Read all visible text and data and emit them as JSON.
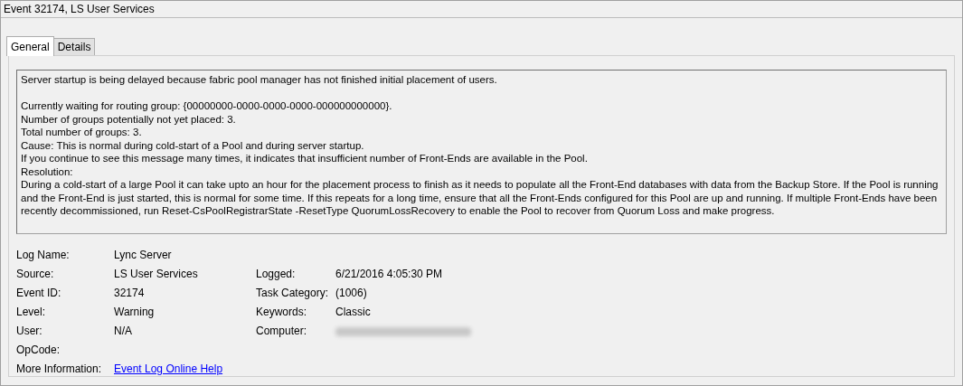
{
  "window": {
    "title": "Event 32174, LS User Services"
  },
  "tabs": [
    {
      "label": "General",
      "selected": true
    },
    {
      "label": "Details",
      "selected": false
    }
  ],
  "message": {
    "summary": "Server startup is being delayed because fabric pool manager has not finished initial placement of users.",
    "paragraphs": [
      "Currently waiting for routing group: {00000000-0000-0000-0000-000000000000}.",
      "Number of groups potentially not yet placed: 3.",
      "Total number of groups: 3.",
      "Cause: This is normal during cold-start of a Pool and during server startup.",
      "If you continue to see this message many times, it indicates that insufficient number of Front-Ends are available in the Pool.",
      "Resolution:",
      "During a cold-start of a large Pool it can take upto an hour for the placement process to finish as it needs to populate all the Front-End databases with data from the Backup Store. If the Pool is running and the Front-End is just started, this is normal for some time. If this repeats for a long time, ensure that all the Front-Ends configured for this Pool are up and running. If multiple Front-Ends have been recently decommissioned, run Reset-CsPoolRegistrarState -ResetType QuorumLossRecovery to enable the Pool to recover from Quorum Loss and make progress."
    ]
  },
  "properties": [
    {
      "left": {
        "label": "Log Name:",
        "value": "Lync Server",
        "kind": "text"
      }
    },
    {
      "left": {
        "label": "Source:",
        "value": "LS User Services",
        "kind": "text"
      },
      "right": {
        "label": "Logged:",
        "value": "6/21/2016 4:05:30 PM",
        "kind": "text"
      }
    },
    {
      "left": {
        "label": "Event ID:",
        "value": "32174",
        "kind": "text"
      },
      "right": {
        "label": "Task Category:",
        "value": "(1006)",
        "kind": "text"
      }
    },
    {
      "left": {
        "label": "Level:",
        "value": "Warning",
        "kind": "text"
      },
      "right": {
        "label": "Keywords:",
        "value": "Classic",
        "kind": "text"
      }
    },
    {
      "left": {
        "label": "User:",
        "value": "N/A",
        "kind": "text"
      },
      "right": {
        "label": "Computer:",
        "kind": "redacted"
      }
    },
    {
      "left": {
        "label": "OpCode:",
        "kind": "empty"
      }
    },
    {
      "left": {
        "label": "More Information:",
        "value": "Event Log Online Help",
        "kind": "link"
      }
    }
  ]
}
